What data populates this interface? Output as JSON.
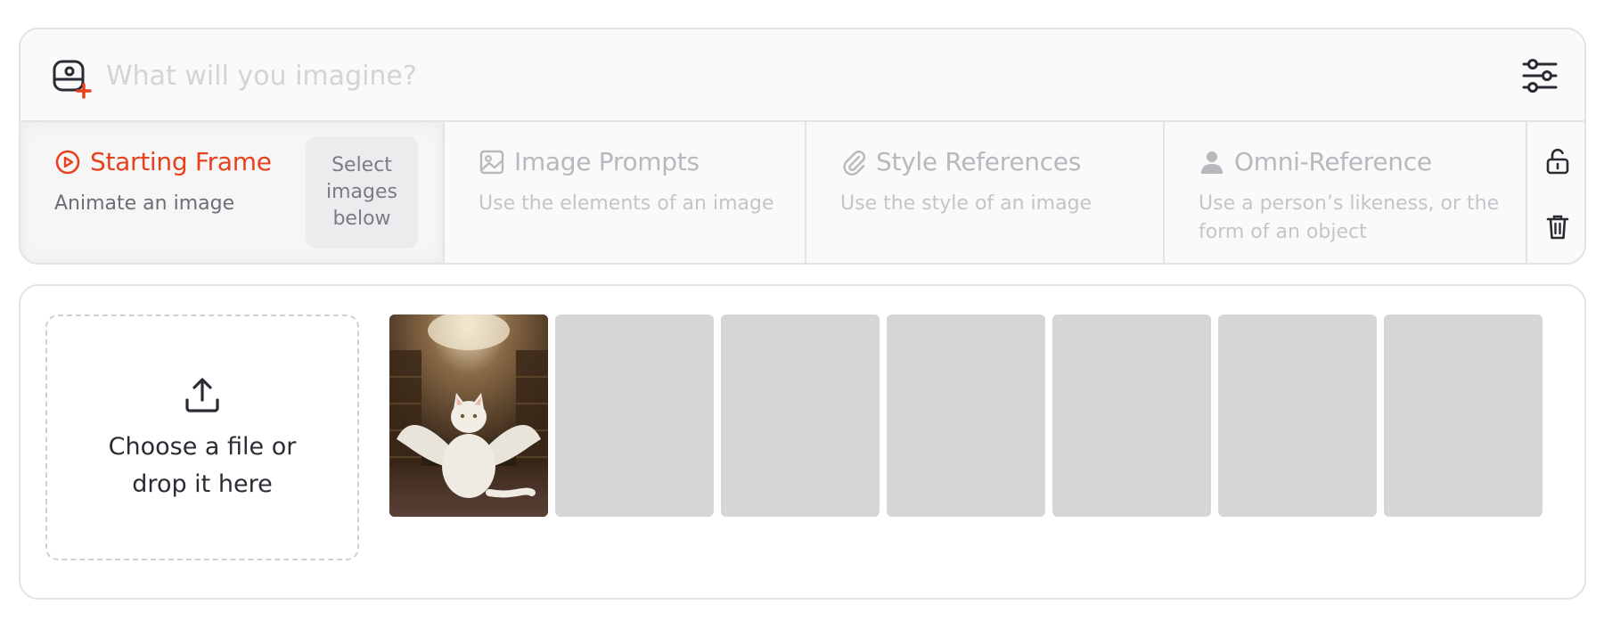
{
  "prompt": {
    "placeholder": "What will you imagine?",
    "value": ""
  },
  "tabs": [
    {
      "title": "Starting Frame",
      "subtitle": "Animate an image",
      "icon": "play-circle-icon",
      "active": true
    },
    {
      "title": "Image Prompts",
      "subtitle": "Use the elements of an image",
      "icon": "image-icon",
      "active": false
    },
    {
      "title": "Style References",
      "subtitle": "Use the style of an image",
      "icon": "paperclip-icon",
      "active": false
    },
    {
      "title": "Omni-Reference",
      "subtitle": "Use a person’s likeness, or the form of an object",
      "icon": "person-icon",
      "active": false
    }
  ],
  "select_box": "Select images below",
  "dropzone": {
    "text": "Choose a file or drop it here",
    "icon": "upload-icon"
  },
  "thumbnails": [
    {
      "kind": "image",
      "description_icon": "winged-cat-library-image"
    },
    {
      "kind": "empty"
    },
    {
      "kind": "empty"
    },
    {
      "kind": "empty"
    },
    {
      "kind": "empty"
    },
    {
      "kind": "empty"
    },
    {
      "kind": "empty"
    }
  ],
  "colors": {
    "accent": "#e8411c",
    "placeholder": "#d3d3d8",
    "muted_text": "#b8b8be",
    "thumb_empty": "#d6d6d9"
  }
}
